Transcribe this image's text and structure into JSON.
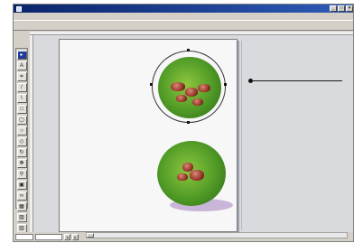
{
  "window": {
    "title": "",
    "minimize_label": "_",
    "maximize_label": "□",
    "close_label": "×"
  },
  "menu": [],
  "tools": [
    {
      "name": "pointer-tool",
      "glyph": "▸"
    },
    {
      "name": "text-tool",
      "glyph": "A"
    },
    {
      "name": "crop-tool",
      "glyph": "⌗"
    },
    {
      "name": "line-tool",
      "glyph": "/"
    },
    {
      "name": "diagonal-line-tool",
      "glyph": "\\"
    },
    {
      "name": "box-tool",
      "glyph": "□"
    },
    {
      "name": "rounded-box-tool",
      "glyph": "▢"
    },
    {
      "name": "oval-tool",
      "glyph": "○"
    },
    {
      "name": "polygon-tool",
      "glyph": "◇"
    },
    {
      "name": "rotate-tool",
      "glyph": "↻"
    },
    {
      "name": "grabber-tool",
      "glyph": "✥"
    },
    {
      "name": "zoom-tool",
      "glyph": "⚲"
    },
    {
      "name": "frame-tool",
      "glyph": "▣"
    },
    {
      "name": "link-tool",
      "glyph": "∞"
    },
    {
      "name": "table-tool",
      "glyph": "▦"
    },
    {
      "name": "picture-tool",
      "glyph": "▨"
    },
    {
      "name": "misc-tool",
      "glyph": "▥"
    }
  ],
  "article": {
    "lines": []
  },
  "status": {
    "zoom": "",
    "page": "",
    "prev_label": "◂",
    "next_label": "▸"
  },
  "colors": {
    "title_bar": "#0a246a",
    "page_shadow": "#9da3ad",
    "leaf_green": "#4f9a26",
    "beetle_red": "#9c3a2c"
  }
}
